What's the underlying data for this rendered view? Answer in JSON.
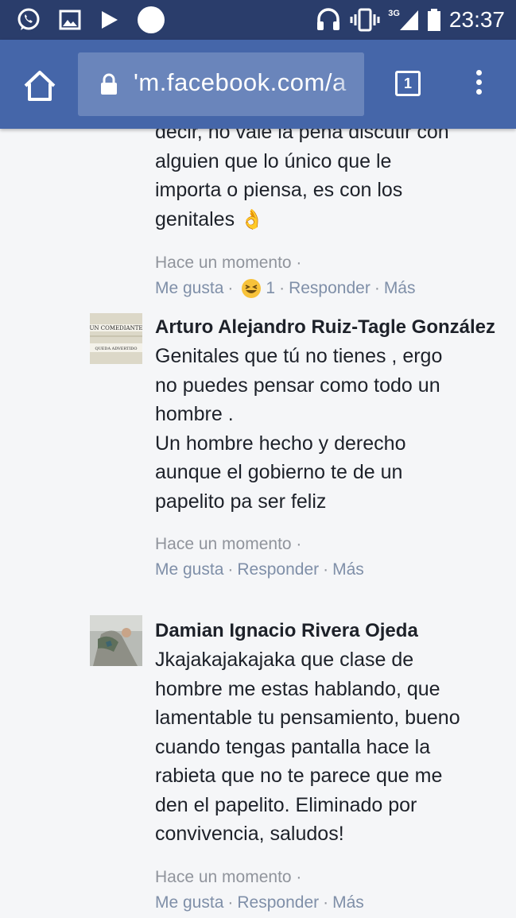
{
  "status_bar": {
    "time": "23:37",
    "network": "3G",
    "left_icons": [
      "whatsapp-icon",
      "gallery-icon",
      "play-icon",
      "circle-icon"
    ],
    "right_icons": [
      "headset-icon",
      "vibrate-icon",
      "signal-icon",
      "battery-icon"
    ]
  },
  "browser": {
    "url": "m.facebook.com/a",
    "url_prefix": "'",
    "tab_count": "1",
    "colors": {
      "toolbar": "#4566a9",
      "status_bar": "#2a3d6b",
      "url_box": "#6a85bb"
    }
  },
  "comments": [
    {
      "author": "",
      "text": "decir, no vale la pena discutir con\nalguien que lo único que le\nimporta o piensa, es con los\ngenitales",
      "emoji": "👌",
      "timestamp": "Hace un momento ·",
      "actions": {
        "like": "Me gusta",
        "reaction_count": "1",
        "reply": "Responder",
        "more": "Más"
      }
    },
    {
      "author": "Arturo Alejandro Ruiz-Tagle González",
      "avatar_text_top": "UN COMEDIANTE",
      "avatar_text_bottom": "QUEDA ADVERTIDO",
      "text": "Genitales que tú no tienes , ergo\nno puedes pensar como todo un\nhombre .\nUn hombre hecho y derecho\naunque el gobierno te de un\npapelito pa ser feliz",
      "timestamp": "Hace un momento ·",
      "actions": {
        "like": "Me gusta",
        "reply": "Responder",
        "more": "Más"
      }
    },
    {
      "author": "Damian Ignacio Rivera Ojeda",
      "text": "Jkajakajakajaka que clase de\nhombre me estas hablando, que\nlamentable tu pensamiento, bueno\ncuando tengas pantalla hace la\nrabieta que no te parece que me\nden el papelito. Eliminado por\nconvivencia, saludos!",
      "timestamp": "Hace un momento ·",
      "actions": {
        "like": "Me gusta",
        "reply": "Responder",
        "more": "Más"
      }
    }
  ]
}
